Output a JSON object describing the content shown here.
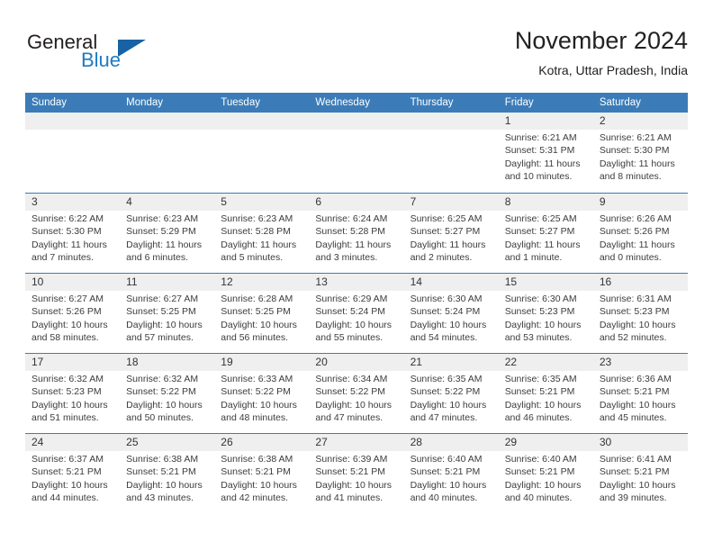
{
  "brand": {
    "word_one": "General",
    "word_two": "Blue",
    "flag_icon": "triangle-flag-icon",
    "colors": {
      "dark": "#231f20",
      "blue": "#1e7bc0",
      "flag": "#1763a5"
    }
  },
  "header": {
    "title": "November 2024",
    "subtitle": "Kotra, Uttar Pradesh, India"
  },
  "theme": {
    "header_bar": "#3b7cb8",
    "daynum_band": "#efefef",
    "cell_bg": "#ffffff",
    "text": "#3c3c3c"
  },
  "weekdays": [
    "Sunday",
    "Monday",
    "Tuesday",
    "Wednesday",
    "Thursday",
    "Friday",
    "Saturday"
  ],
  "weeks": [
    [
      {
        "day": "",
        "sunrise": "",
        "sunset": "",
        "daylight": ""
      },
      {
        "day": "",
        "sunrise": "",
        "sunset": "",
        "daylight": ""
      },
      {
        "day": "",
        "sunrise": "",
        "sunset": "",
        "daylight": ""
      },
      {
        "day": "",
        "sunrise": "",
        "sunset": "",
        "daylight": ""
      },
      {
        "day": "",
        "sunrise": "",
        "sunset": "",
        "daylight": ""
      },
      {
        "day": "1",
        "sunrise": "Sunrise: 6:21 AM",
        "sunset": "Sunset: 5:31 PM",
        "daylight": "Daylight: 11 hours and 10 minutes."
      },
      {
        "day": "2",
        "sunrise": "Sunrise: 6:21 AM",
        "sunset": "Sunset: 5:30 PM",
        "daylight": "Daylight: 11 hours and 8 minutes."
      }
    ],
    [
      {
        "day": "3",
        "sunrise": "Sunrise: 6:22 AM",
        "sunset": "Sunset: 5:30 PM",
        "daylight": "Daylight: 11 hours and 7 minutes."
      },
      {
        "day": "4",
        "sunrise": "Sunrise: 6:23 AM",
        "sunset": "Sunset: 5:29 PM",
        "daylight": "Daylight: 11 hours and 6 minutes."
      },
      {
        "day": "5",
        "sunrise": "Sunrise: 6:23 AM",
        "sunset": "Sunset: 5:28 PM",
        "daylight": "Daylight: 11 hours and 5 minutes."
      },
      {
        "day": "6",
        "sunrise": "Sunrise: 6:24 AM",
        "sunset": "Sunset: 5:28 PM",
        "daylight": "Daylight: 11 hours and 3 minutes."
      },
      {
        "day": "7",
        "sunrise": "Sunrise: 6:25 AM",
        "sunset": "Sunset: 5:27 PM",
        "daylight": "Daylight: 11 hours and 2 minutes."
      },
      {
        "day": "8",
        "sunrise": "Sunrise: 6:25 AM",
        "sunset": "Sunset: 5:27 PM",
        "daylight": "Daylight: 11 hours and 1 minute."
      },
      {
        "day": "9",
        "sunrise": "Sunrise: 6:26 AM",
        "sunset": "Sunset: 5:26 PM",
        "daylight": "Daylight: 11 hours and 0 minutes."
      }
    ],
    [
      {
        "day": "10",
        "sunrise": "Sunrise: 6:27 AM",
        "sunset": "Sunset: 5:26 PM",
        "daylight": "Daylight: 10 hours and 58 minutes."
      },
      {
        "day": "11",
        "sunrise": "Sunrise: 6:27 AM",
        "sunset": "Sunset: 5:25 PM",
        "daylight": "Daylight: 10 hours and 57 minutes."
      },
      {
        "day": "12",
        "sunrise": "Sunrise: 6:28 AM",
        "sunset": "Sunset: 5:25 PM",
        "daylight": "Daylight: 10 hours and 56 minutes."
      },
      {
        "day": "13",
        "sunrise": "Sunrise: 6:29 AM",
        "sunset": "Sunset: 5:24 PM",
        "daylight": "Daylight: 10 hours and 55 minutes."
      },
      {
        "day": "14",
        "sunrise": "Sunrise: 6:30 AM",
        "sunset": "Sunset: 5:24 PM",
        "daylight": "Daylight: 10 hours and 54 minutes."
      },
      {
        "day": "15",
        "sunrise": "Sunrise: 6:30 AM",
        "sunset": "Sunset: 5:23 PM",
        "daylight": "Daylight: 10 hours and 53 minutes."
      },
      {
        "day": "16",
        "sunrise": "Sunrise: 6:31 AM",
        "sunset": "Sunset: 5:23 PM",
        "daylight": "Daylight: 10 hours and 52 minutes."
      }
    ],
    [
      {
        "day": "17",
        "sunrise": "Sunrise: 6:32 AM",
        "sunset": "Sunset: 5:23 PM",
        "daylight": "Daylight: 10 hours and 51 minutes."
      },
      {
        "day": "18",
        "sunrise": "Sunrise: 6:32 AM",
        "sunset": "Sunset: 5:22 PM",
        "daylight": "Daylight: 10 hours and 50 minutes."
      },
      {
        "day": "19",
        "sunrise": "Sunrise: 6:33 AM",
        "sunset": "Sunset: 5:22 PM",
        "daylight": "Daylight: 10 hours and 48 minutes."
      },
      {
        "day": "20",
        "sunrise": "Sunrise: 6:34 AM",
        "sunset": "Sunset: 5:22 PM",
        "daylight": "Daylight: 10 hours and 47 minutes."
      },
      {
        "day": "21",
        "sunrise": "Sunrise: 6:35 AM",
        "sunset": "Sunset: 5:22 PM",
        "daylight": "Daylight: 10 hours and 47 minutes."
      },
      {
        "day": "22",
        "sunrise": "Sunrise: 6:35 AM",
        "sunset": "Sunset: 5:21 PM",
        "daylight": "Daylight: 10 hours and 46 minutes."
      },
      {
        "day": "23",
        "sunrise": "Sunrise: 6:36 AM",
        "sunset": "Sunset: 5:21 PM",
        "daylight": "Daylight: 10 hours and 45 minutes."
      }
    ],
    [
      {
        "day": "24",
        "sunrise": "Sunrise: 6:37 AM",
        "sunset": "Sunset: 5:21 PM",
        "daylight": "Daylight: 10 hours and 44 minutes."
      },
      {
        "day": "25",
        "sunrise": "Sunrise: 6:38 AM",
        "sunset": "Sunset: 5:21 PM",
        "daylight": "Daylight: 10 hours and 43 minutes."
      },
      {
        "day": "26",
        "sunrise": "Sunrise: 6:38 AM",
        "sunset": "Sunset: 5:21 PM",
        "daylight": "Daylight: 10 hours and 42 minutes."
      },
      {
        "day": "27",
        "sunrise": "Sunrise: 6:39 AM",
        "sunset": "Sunset: 5:21 PM",
        "daylight": "Daylight: 10 hours and 41 minutes."
      },
      {
        "day": "28",
        "sunrise": "Sunrise: 6:40 AM",
        "sunset": "Sunset: 5:21 PM",
        "daylight": "Daylight: 10 hours and 40 minutes."
      },
      {
        "day": "29",
        "sunrise": "Sunrise: 6:40 AM",
        "sunset": "Sunset: 5:21 PM",
        "daylight": "Daylight: 10 hours and 40 minutes."
      },
      {
        "day": "30",
        "sunrise": "Sunrise: 6:41 AM",
        "sunset": "Sunset: 5:21 PM",
        "daylight": "Daylight: 10 hours and 39 minutes."
      }
    ]
  ]
}
